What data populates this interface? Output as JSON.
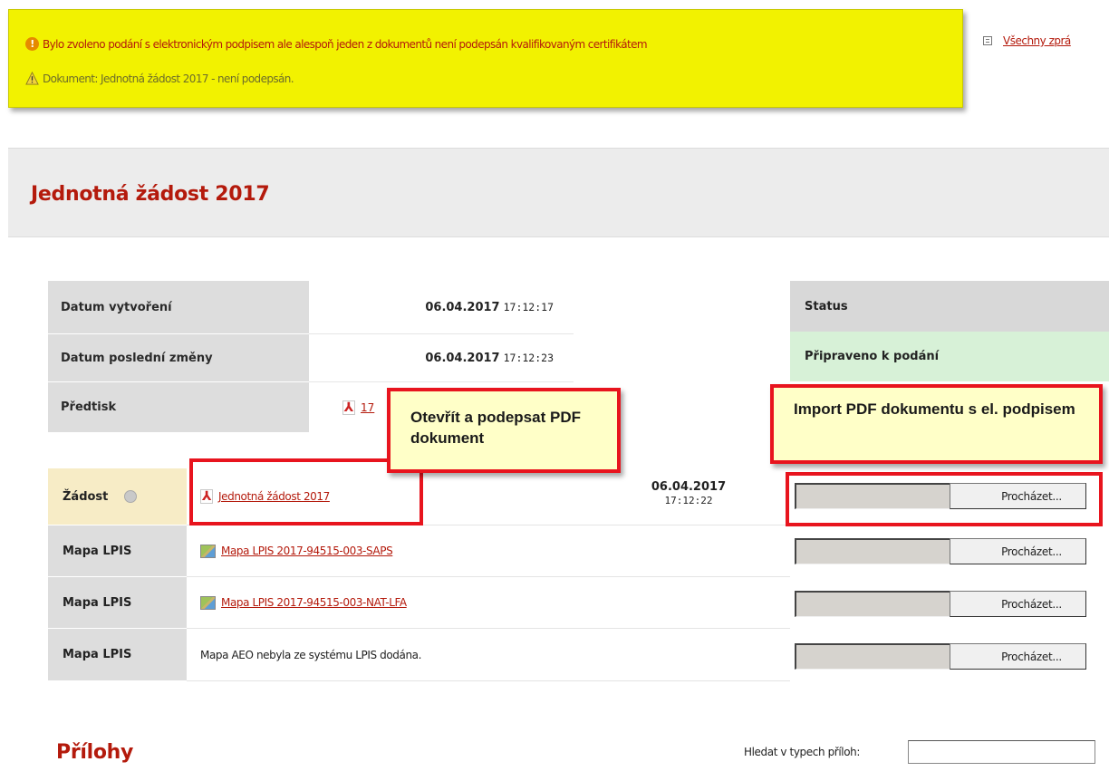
{
  "alert": {
    "error_text": "Bylo zvoleno podání s elektronickým podpisem ale alespoň jeden z dokumentů není podepsán kvalifikovaným certifikátem",
    "warning_text": "Dokument: Jednotná žádost 2017 - není podepsán.",
    "all_messages_link": "Všechny zprá"
  },
  "page": {
    "title": "Jednotná žádost 2017"
  },
  "info": {
    "created_label": "Datum vytvoření",
    "created_date": "06.04.2017",
    "created_time": "17:12:17",
    "modified_label": "Datum poslední změny",
    "modified_date": "06.04.2017",
    "modified_time": "17:12:23",
    "preprint_label": "Předtisk",
    "preprint_link": "17"
  },
  "status": {
    "label": "Status",
    "value": "Připraveno k podání"
  },
  "documents": [
    {
      "label": "Žádost",
      "link": "Jednotná žádost 2017",
      "date": "06.04.2017",
      "time": "17:12:22",
      "browse": "Procházet..."
    },
    {
      "label": "Mapa LPIS",
      "link": "Mapa LPIS 2017-94515-003-SAPS",
      "browse": "Procházet..."
    },
    {
      "label": "Mapa LPIS",
      "link": "Mapa LPIS 2017-94515-003-NAT-LFA",
      "browse": "Procházet..."
    },
    {
      "label": "Mapa LPIS",
      "text": "Mapa AEO nebyla ze systému LPIS dodána.",
      "browse": "Procházet..."
    }
  ],
  "annotations": {
    "open_sign": "Otevřít a podepsat PDF dokument",
    "import_pdf": "Import PDF dokumentu s el. podpisem"
  },
  "attachments": {
    "title": "Přílohy",
    "search_label": "Hledat v typech příloh:",
    "search_value": ""
  },
  "colors": {
    "accent": "#b41a0c",
    "alert_bg": "#f2f200",
    "status_ok": "#d7f1d7",
    "annotation_border": "#e8141e",
    "annotation_bg": "#ffffc8"
  }
}
